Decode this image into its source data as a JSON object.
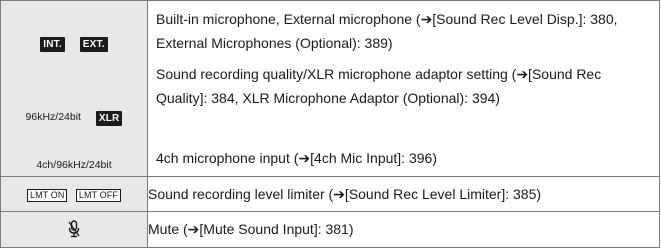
{
  "rows": {
    "group": {
      "icons": {
        "int": "INT.",
        "ext": "EXT.",
        "rate_label": "96kHz/24bit",
        "xlr": "XLR",
        "ch4_label": "4ch/96kHz/24bit"
      },
      "desc1": "Built-in microphone, External microphone (➔[Sound Rec Level Disp.]: 380, External Microphones (Optional): 389)",
      "desc2": "Sound recording quality/XLR microphone adaptor setting (➔[Sound Rec Quality]: 384, XLR Microphone Adaptor (Optional): 394)",
      "desc3": "4ch microphone input (➔[4ch Mic Input]: 396)"
    },
    "limiter": {
      "lmt_on": "LMT ON",
      "lmt_off": "LMT OFF",
      "desc": "Sound recording level limiter (➔[Sound Rec Level Limiter]: 385)"
    },
    "mute": {
      "icon": "microphone-muted-icon",
      "desc": "Mute (➔[Mute Sound Input]: 381)"
    }
  }
}
